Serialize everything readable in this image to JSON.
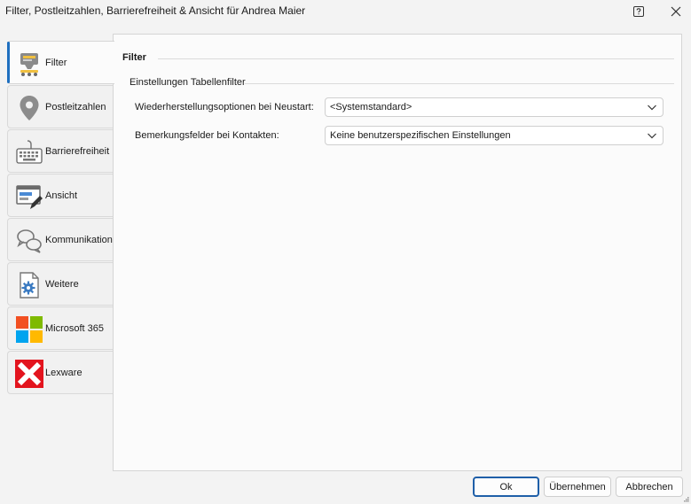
{
  "window": {
    "title": "Filter, Postleitzahlen, Barrierefreiheit & Ansicht für Andrea Maier",
    "help_icon": "help-question-icon",
    "close_icon": "close-icon"
  },
  "sidebar": {
    "items": [
      {
        "label": "Filter",
        "icon": "filter-icon",
        "active": true
      },
      {
        "label": "Postleitzahlen",
        "icon": "location-pin-icon"
      },
      {
        "label": "Barrierefreiheit",
        "icon": "keyboard-icon"
      },
      {
        "label": "Ansicht",
        "icon": "view-edit-icon"
      },
      {
        "label": "Kommunikation",
        "icon": "speech-bubbles-icon"
      },
      {
        "label": "Weitere",
        "icon": "settings-document-icon"
      },
      {
        "label": "Microsoft 365",
        "icon": "microsoft-365-icon"
      },
      {
        "label": "Lexware",
        "icon": "lexware-icon"
      }
    ]
  },
  "main": {
    "section_title": "Filter",
    "group_title": "Einstellungen Tabellenfilter",
    "rows": [
      {
        "label": "Wiederherstellungsoptionen bei Neustart:",
        "value": "<Systemstandard>"
      },
      {
        "label": "Bemerkungsfelder bei Kontakten:",
        "value": "Keine benutzerspezifischen Einstellungen"
      }
    ]
  },
  "footer": {
    "ok_label": "Ok",
    "apply_label": "Übernehmen",
    "cancel_label": "Abbrechen"
  },
  "colors": {
    "accent": "#1f6fbf",
    "ok_border": "#1f5fa8",
    "lexware_red": "#e3141e"
  }
}
